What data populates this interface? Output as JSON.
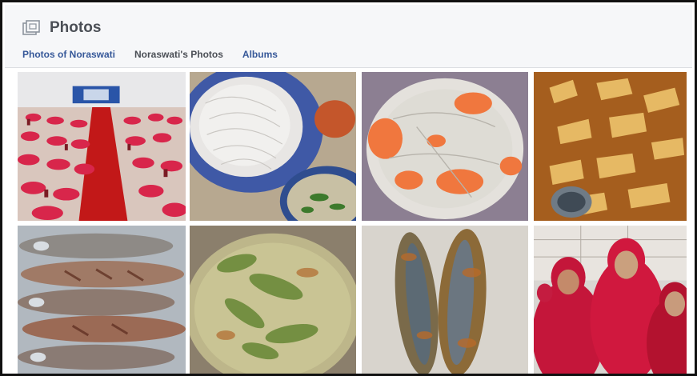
{
  "header": {
    "title": "Photos",
    "icon": "photos-icon"
  },
  "tabs": [
    {
      "label": "Photos of Noraswati",
      "active": false
    },
    {
      "label": "Noraswati's Photos",
      "active": true
    },
    {
      "label": "Albums",
      "active": false
    }
  ],
  "photos": [
    {
      "name": "photo-banquet-hall"
    },
    {
      "name": "photo-noodle-plate"
    },
    {
      "name": "photo-shrimp-dish"
    },
    {
      "name": "photo-curry-bowl"
    },
    {
      "name": "photo-grilled-fish"
    },
    {
      "name": "photo-green-curry"
    },
    {
      "name": "photo-fried-fish"
    },
    {
      "name": "photo-group-selfie"
    }
  ],
  "colors": {
    "link": "#365899",
    "header_bg": "#f6f7f9",
    "title": "#4b4f56"
  }
}
